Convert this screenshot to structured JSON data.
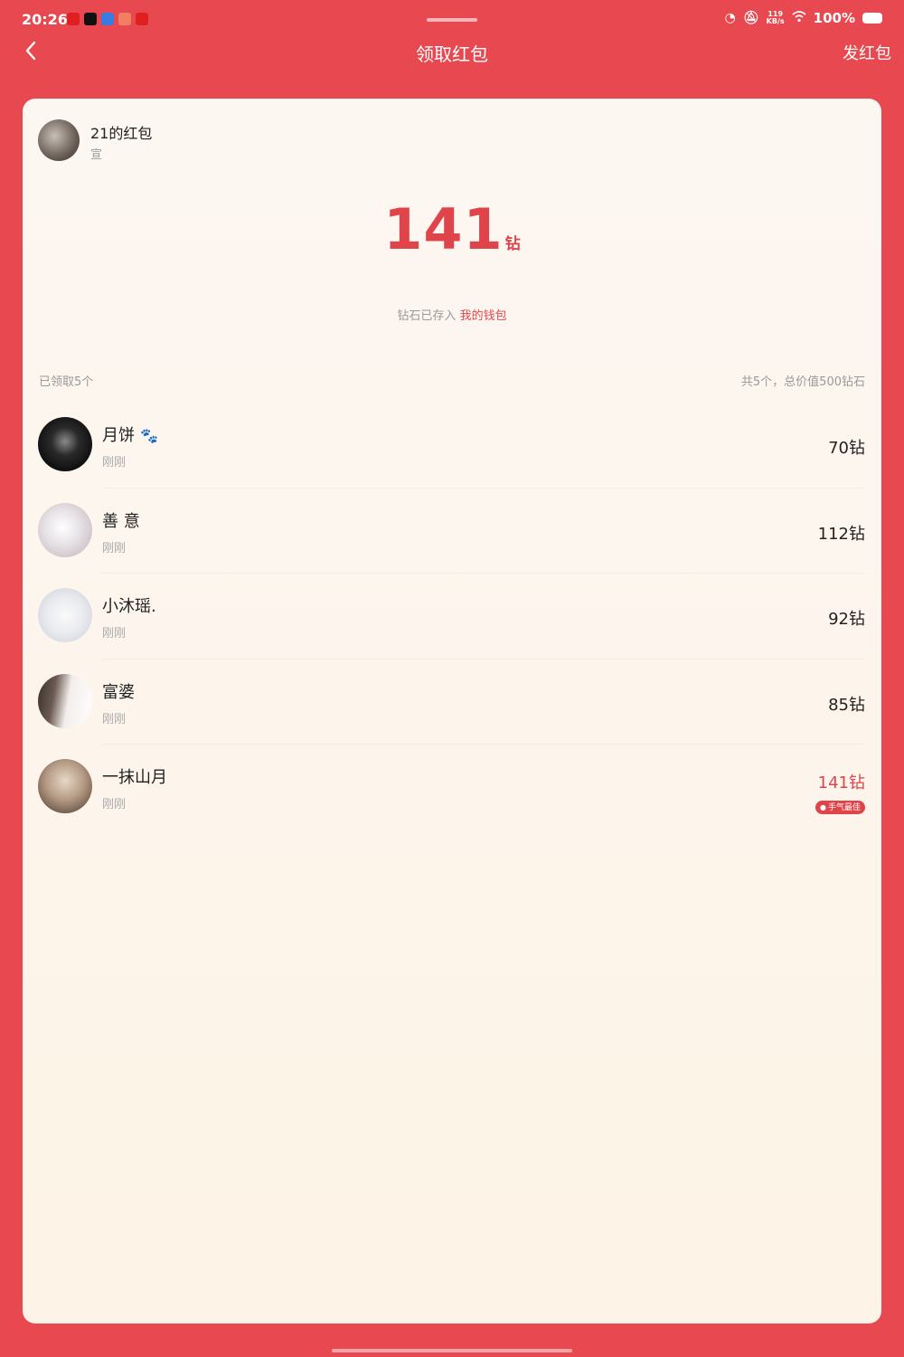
{
  "status_bar": {
    "time": "20:26",
    "net_speed_value": "119",
    "net_speed_unit": "KB/s",
    "battery": "100%",
    "notification_icons": [
      {
        "name": "app-notif-icon-1",
        "glyph": "",
        "color": "#E02020"
      },
      {
        "name": "app-notif-icon-2",
        "glyph": "",
        "color": "#111111"
      },
      {
        "name": "app-notif-icon-3",
        "glyph": "",
        "color": "#3B7BE0"
      },
      {
        "name": "app-notif-icon-4",
        "glyph": "",
        "color": "#E8484F"
      },
      {
        "name": "app-notif-icon-5",
        "glyph": "",
        "color": "#E02020"
      }
    ]
  },
  "header": {
    "back_icon": "chevron-left-icon",
    "title": "领取红包",
    "send_label": "发红包"
  },
  "sender": {
    "name": "21的红包",
    "subtitle": "宣"
  },
  "amount": {
    "value": "141",
    "unit": "钻"
  },
  "wallet_note": {
    "text": "钻石已存入",
    "link": "我的钱包"
  },
  "summary": {
    "left": "已领取5个",
    "right": "共5个，总价值500钻石"
  },
  "claims": [
    {
      "name": "月饼",
      "paw": "🐾",
      "time": "刚刚",
      "value": "70钻"
    },
    {
      "name": "善 意",
      "time": "刚刚",
      "value": "112钻"
    },
    {
      "name": "小沐瑶.",
      "time": "刚刚",
      "value": "92钻"
    },
    {
      "name": "富婆",
      "time": "刚刚",
      "value": "85钻"
    },
    {
      "name": "一抹山月",
      "time": "刚刚",
      "value": "141钻",
      "badge": "手气最佳"
    }
  ],
  "colors": {
    "accent": "#E0444B",
    "background": "#E8484F",
    "card": "#FDF7F2"
  }
}
